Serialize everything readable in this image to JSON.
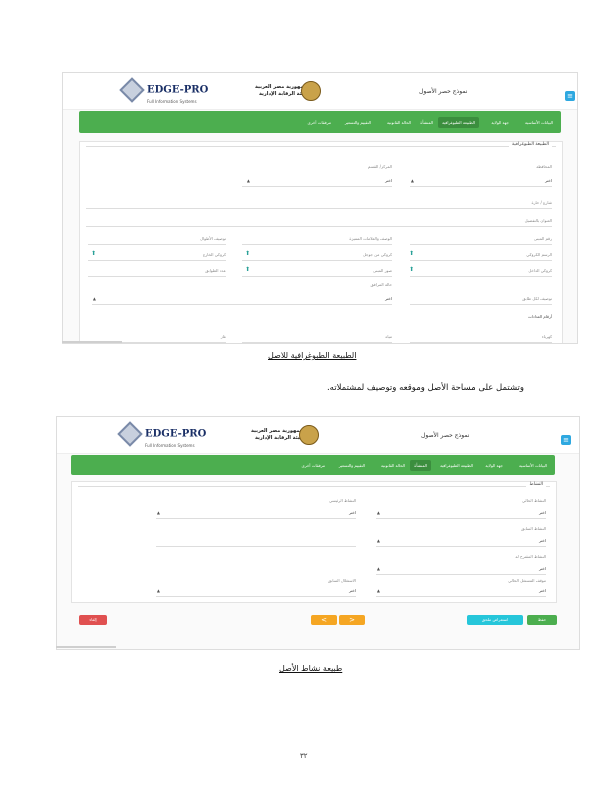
{
  "header": {
    "logo_text": "EDGE-PRO",
    "logo_sub": "Full Information Systems",
    "agency_line1": "جمهورية مصر العربية",
    "agency_line2": "هيئة الرقابة الإدارية",
    "form_title": "نموذج حصر الأصول",
    "menu_icon": "≡"
  },
  "tabs1": [
    "البيانات الأساسية",
    "جهة الولاية",
    "الطبيعة الطبوغرافية",
    "المنشأة",
    "الحالة القانونية",
    "التقييم والتسعير",
    "مرفقات أخرى"
  ],
  "tabs2": [
    "البيانات الأساسية",
    "جهة الولاية",
    "الطبيعة الطبوغرافية",
    "المنشأة",
    "الحالة القانونية",
    "التقييم والتسعير",
    "مرفقات أخرى"
  ],
  "section1": {
    "legend": "الطبيعة الطبوغرافية",
    "governorate": "المحافظة",
    "choose": "اختر",
    "center": "المركز/ القسم",
    "street": "شارع / حارة",
    "address": "العنوان بالتفصيل",
    "building_no": "رقم المبنى",
    "landmarks": "الوصف والعلامات المميزة",
    "lengths_desc": "توصيف الأطوال",
    "graphic_drawing": "الرسم الكروكي",
    "site_map": "كروكي من جوجل",
    "outer_sketch": "كروكي الخارج",
    "inner_sketch": "كروكي الداخل",
    "building_photo": "صور المبنى",
    "floors_no": "عدد الطوابق",
    "floor_desc": "توصيف لكل طابق",
    "utilities_state": "حالة المرافق",
    "meters": "أرقام العدادات",
    "electricity": "كهرباء",
    "water": "مياه",
    "gas": "غاز"
  },
  "caption1": "الطبيعة الطبوغرافية للاصل",
  "body_text": "وتشتمل على مساحة الأصل وموقعه وتوصيف لمشتملاته.",
  "section2": {
    "legend": "النشاط",
    "current_activity": "النشاط الحالي",
    "choose": "اختر",
    "main_activity": "النشاط الرئيسي",
    "prev_activity": "النشاط السابق",
    "proposed_activity": "النشاط المقترح له",
    "current_user": "موقف المستغل الحالي",
    "prev_user": "الاستغلال السابق"
  },
  "buttons2": {
    "save": "حفظ",
    "save_exit": "استعراض ملحق",
    "next": "<",
    "prev": ">",
    "cancel": "إلغاء"
  },
  "caption2": "طبيعة نشاط الأصل",
  "page_number": "٣٢",
  "colors": {
    "green": "#4cae4f",
    "blue": "#2ea8e0",
    "orange": "#f5a623",
    "red": "#e05050",
    "teal": "#26c6da"
  }
}
